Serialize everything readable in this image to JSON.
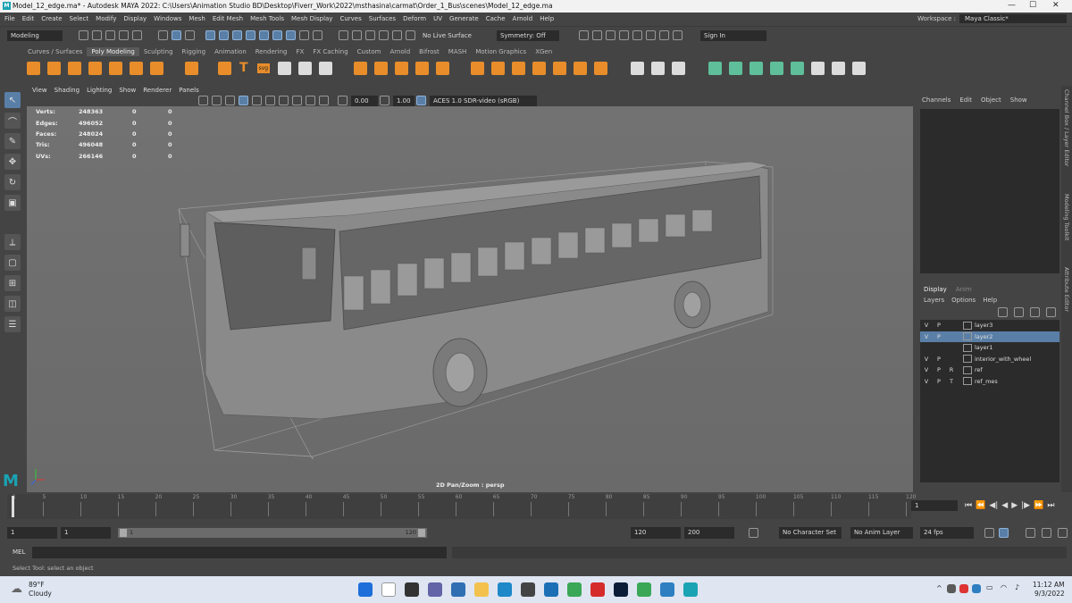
{
  "window": {
    "title": "Model_12_edge.ma* - Autodesk MAYA 2022: C:\\Users\\Animation Studio BD\\Desktop\\Fiverr_Work\\2022\\msthasina\\carmat\\Order_1_Bus\\scenes\\Model_12_edge.ma",
    "logo": "M",
    "minimize": "—",
    "maximize": "☐",
    "close": "✕"
  },
  "menubar": {
    "items": [
      "File",
      "Edit",
      "Create",
      "Select",
      "Modify",
      "Display",
      "Windows",
      "Mesh",
      "Edit Mesh",
      "Mesh Tools",
      "Mesh Display",
      "Curves",
      "Surfaces",
      "Deform",
      "UV",
      "Generate",
      "Cache",
      "Arnold",
      "Help"
    ],
    "workspace_label": "Workspace :",
    "workspace_value": "Maya Classic*"
  },
  "statusline": {
    "mode": "Modeling",
    "live_surface": "No Live Surface",
    "symmetry": "Symmetry: Off",
    "sign_in": "Sign In"
  },
  "shelf": {
    "tabs": [
      "Curves / Surfaces",
      "Poly Modeling",
      "Sculpting",
      "Rigging",
      "Animation",
      "Rendering",
      "FX",
      "FX Caching",
      "Custom",
      "Arnold",
      "Bifrost",
      "MASH",
      "Motion Graphics",
      "XGen"
    ],
    "active_tab": "Poly Modeling",
    "text_tool": "T",
    "svg_tool": "svg"
  },
  "viewport": {
    "menu": [
      "View",
      "Shading",
      "Lighting",
      "Show",
      "Renderer",
      "Panels"
    ],
    "exposure": "0.00",
    "gamma": "1.00",
    "color_space": "ACES 1.0 SDR-video (sRGB)",
    "hud": [
      {
        "label": "Verts:",
        "a": "248363",
        "b": "0",
        "c": "0"
      },
      {
        "label": "Edges:",
        "a": "496052",
        "b": "0",
        "c": "0"
      },
      {
        "label": "Faces:",
        "a": "248024",
        "b": "0",
        "c": "0"
      },
      {
        "label": "Tris:",
        "a": "496048",
        "b": "0",
        "c": "0"
      },
      {
        "label": "UVs:",
        "a": "266146",
        "b": "0",
        "c": "0"
      }
    ],
    "camera_label": "2D Pan/Zoom : persp"
  },
  "channelbox": {
    "menu": [
      "Channels",
      "Edit",
      "Object",
      "Show"
    ]
  },
  "sidetabs": [
    "Channel Box / Layer Editor",
    "Modeling Toolkit",
    "Attribute Editor"
  ],
  "layers": {
    "tabs": [
      "Display",
      "Anim"
    ],
    "menu": [
      "Layers",
      "Options",
      "Help"
    ],
    "rows": [
      {
        "v": "V",
        "p": "P",
        "t": "",
        "name": "layer3",
        "selected": false
      },
      {
        "v": "V",
        "p": "P",
        "t": "",
        "name": "layer2",
        "selected": true
      },
      {
        "v": "",
        "p": "",
        "t": "",
        "name": "layer1",
        "selected": false
      },
      {
        "v": "V",
        "p": "P",
        "t": "",
        "name": "interior_with_wheel",
        "selected": false
      },
      {
        "v": "V",
        "p": "P",
        "t": "R",
        "name": "ref",
        "selected": false
      },
      {
        "v": "V",
        "p": "P",
        "t": "T",
        "name": "ref_mes",
        "selected": false
      }
    ]
  },
  "timeslider": {
    "ticks": [
      "1",
      "5",
      "10",
      "15",
      "20",
      "25",
      "30",
      "35",
      "40",
      "45",
      "50",
      "55",
      "60",
      "65",
      "70",
      "75",
      "80",
      "85",
      "90",
      "95",
      "100",
      "105",
      "110",
      "115",
      "120"
    ],
    "current_frame": "1"
  },
  "rangeslider": {
    "start": "1",
    "anim_start": "1",
    "range_start": "1",
    "range_end": "120",
    "anim_end": "120",
    "end": "200",
    "character_set": "No Character Set",
    "anim_layer": "No Anim Layer",
    "fps": "24 fps"
  },
  "commandline": {
    "label": "MEL"
  },
  "helpline": {
    "text": "Select Tool: select an object"
  },
  "taskbar": {
    "temperature": "89°F",
    "weather": "Cloudy",
    "time": "11:12 AM",
    "date": "9/3/2022"
  }
}
